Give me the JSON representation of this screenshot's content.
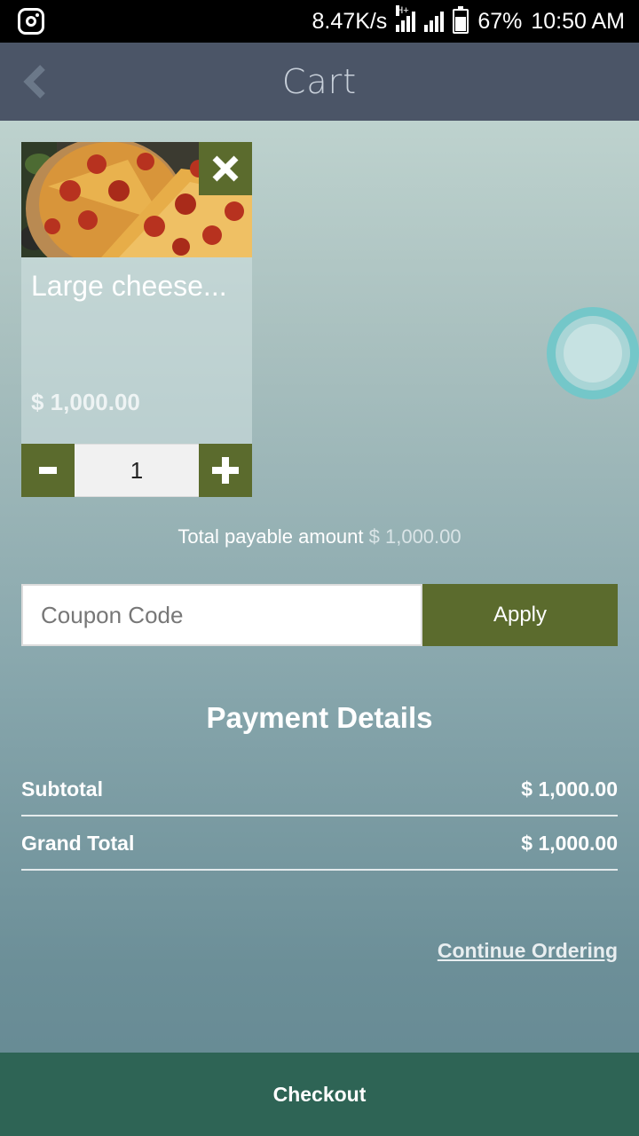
{
  "status_bar": {
    "network_speed": "8.47K/s",
    "network_type": "H+",
    "battery_percent": "67%",
    "battery_level": 0.67,
    "time": "10:50 AM",
    "icons": [
      "instagram-icon",
      "signal-icon",
      "battery-icon"
    ]
  },
  "header": {
    "title": "Cart",
    "back_icon": "chevron-left-icon"
  },
  "cart": {
    "items": [
      {
        "name": "Large cheese...",
        "price": "$ 1,000.00",
        "quantity": "1",
        "image": "pepperoni-pizza-image"
      }
    ],
    "remove_icon": "close-icon",
    "decrement_label": "-",
    "increment_label": "+"
  },
  "total": {
    "label": "Total payable amount",
    "amount": "$ 1,000.00"
  },
  "coupon": {
    "placeholder": "Coupon Code",
    "value": "",
    "apply_label": "Apply"
  },
  "payment": {
    "title": "Payment Details",
    "rows": [
      {
        "label": "Subtotal",
        "value": "$ 1,000.00"
      },
      {
        "label": "Grand Total",
        "value": "$ 1,000.00"
      }
    ]
  },
  "links": {
    "continue_ordering": "Continue Ordering"
  },
  "footer": {
    "checkout_label": "Checkout"
  },
  "colors": {
    "app_bar": "#4b5567",
    "accent_green": "#5b6b2d",
    "checkout_green": "#2e6455",
    "fab_ring": "#74c7c9"
  }
}
